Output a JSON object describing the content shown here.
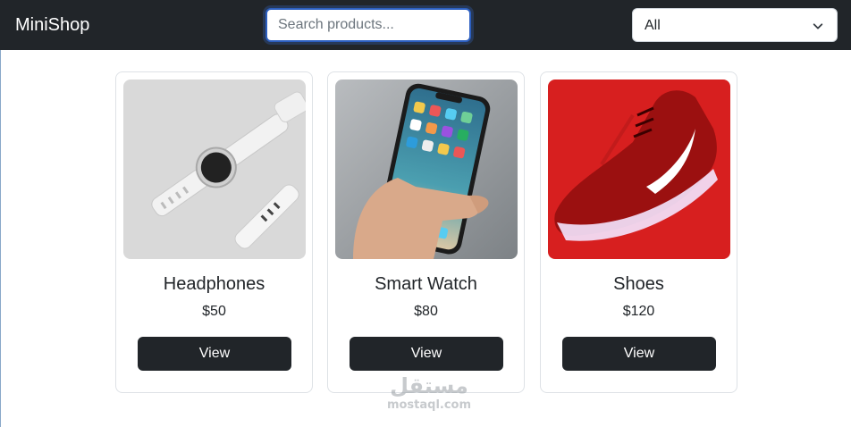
{
  "navbar": {
    "brand": "MiniShop",
    "search_placeholder": "Search products...",
    "search_value": "",
    "category_select": {
      "selected": "All"
    },
    "bg_color": "#212529"
  },
  "products": [
    {
      "name": "Headphones",
      "price": "$50",
      "button_label": "View",
      "image": "smartwatch-photo"
    },
    {
      "name": "Smart Watch",
      "price": "$80",
      "button_label": "View",
      "image": "smartphone-in-hand-photo"
    },
    {
      "name": "Shoes",
      "price": "$120",
      "button_label": "View",
      "image": "red-sneaker-photo"
    }
  ],
  "watermark": {
    "arabic": "مستقل",
    "latin": "mostaql.com"
  },
  "colors": {
    "primary_dark": "#212529",
    "search_focus": "#2c5fc0",
    "card_border": "#dee2e6",
    "shoe_bg": "#d71f1f"
  }
}
